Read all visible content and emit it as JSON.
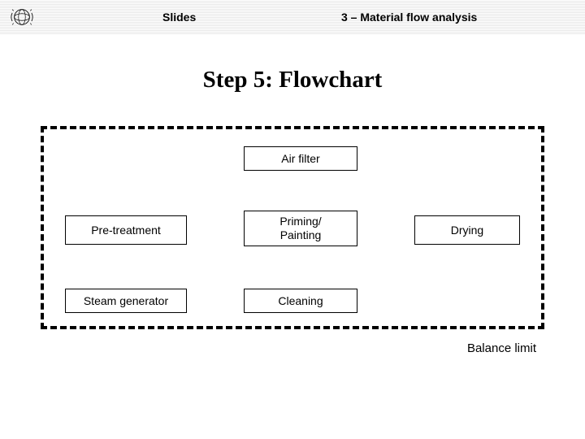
{
  "header": {
    "slides_label": "Slides",
    "topic_label": "3 – Material flow analysis"
  },
  "title": "Step 5: Flowchart",
  "diagram": {
    "balance_label": "Balance limit",
    "nodes": {
      "air_filter": "Air filter",
      "pre_treatment": "Pre-treatment",
      "priming_painting": "Priming/\nPainting",
      "drying": "Drying",
      "steam_generator": "Steam generator",
      "cleaning": "Cleaning"
    }
  }
}
